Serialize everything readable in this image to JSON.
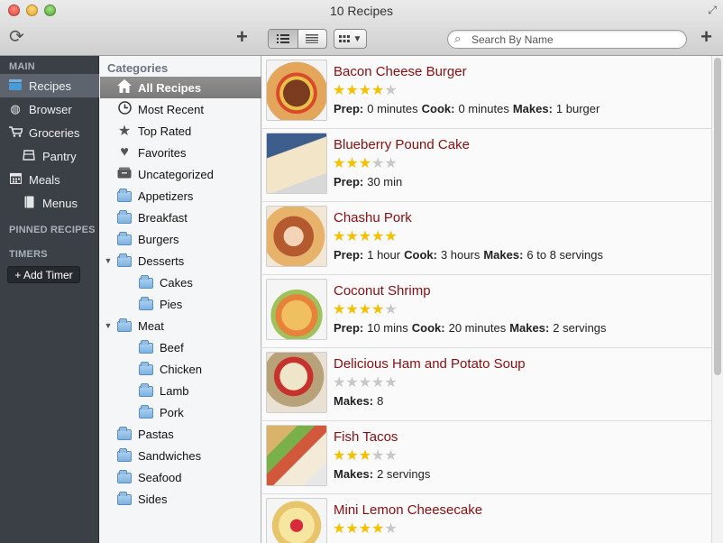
{
  "window": {
    "title": "10 Recipes"
  },
  "search": {
    "placeholder": "Search By Name"
  },
  "sidebar": {
    "main_header": "MAIN",
    "items": [
      {
        "label": "Recipes",
        "icon": "recipes-icon"
      },
      {
        "label": "Browser",
        "icon": "globe-icon"
      },
      {
        "label": "Groceries",
        "icon": "cart-icon"
      },
      {
        "label": "Pantry",
        "icon": "pantry-icon"
      },
      {
        "label": "Meals",
        "icon": "calendar-icon"
      },
      {
        "label": "Menus",
        "icon": "book-icon"
      }
    ],
    "pinned_header": "PINNED RECIPES",
    "timers_header": "TIMERS",
    "add_timer_label": "+ Add Timer"
  },
  "categories": {
    "title": "Categories",
    "items": [
      {
        "label": "All Recipes"
      },
      {
        "label": "Most Recent"
      },
      {
        "label": "Top Rated"
      },
      {
        "label": "Favorites"
      },
      {
        "label": "Uncategorized"
      },
      {
        "label": "Appetizers"
      },
      {
        "label": "Breakfast"
      },
      {
        "label": "Burgers"
      },
      {
        "label": "Desserts"
      },
      {
        "label": "Cakes"
      },
      {
        "label": "Pies"
      },
      {
        "label": "Meat"
      },
      {
        "label": "Beef"
      },
      {
        "label": "Chicken"
      },
      {
        "label": "Lamb"
      },
      {
        "label": "Pork"
      },
      {
        "label": "Pastas"
      },
      {
        "label": "Sandwiches"
      },
      {
        "label": "Seafood"
      },
      {
        "label": "Sides"
      }
    ]
  },
  "labels": {
    "prep": "Prep:",
    "cook": "Cook:",
    "makes": "Makes:"
  },
  "recipes": [
    {
      "name": "Bacon Cheese Burger",
      "rating": 4,
      "prep": "0 minutes",
      "cook": "0 minutes",
      "makes": "1 burger"
    },
    {
      "name": "Blueberry Pound Cake",
      "rating": 3,
      "prep": "30 min",
      "cook": "",
      "makes": ""
    },
    {
      "name": "Chashu Pork",
      "rating": 5,
      "prep": "1 hour",
      "cook": "3 hours",
      "makes": "6 to 8 servings"
    },
    {
      "name": "Coconut Shrimp",
      "rating": 4,
      "prep": "10 mins",
      "cook": "20 minutes",
      "makes": "2 servings"
    },
    {
      "name": "Delicious Ham and Potato Soup",
      "rating": 0,
      "prep": "",
      "cook": "",
      "makes": "8"
    },
    {
      "name": "Fish Tacos",
      "rating": 3,
      "prep": "",
      "cook": "",
      "makes": "2 servings"
    },
    {
      "name": "Mini Lemon Cheesecake",
      "rating": 4,
      "prep": "",
      "cook": "",
      "makes": ""
    }
  ],
  "colors": {
    "recipe_title": "#8b0d10",
    "star": "#f5c000",
    "sidebar_bg": "#3b4047"
  }
}
